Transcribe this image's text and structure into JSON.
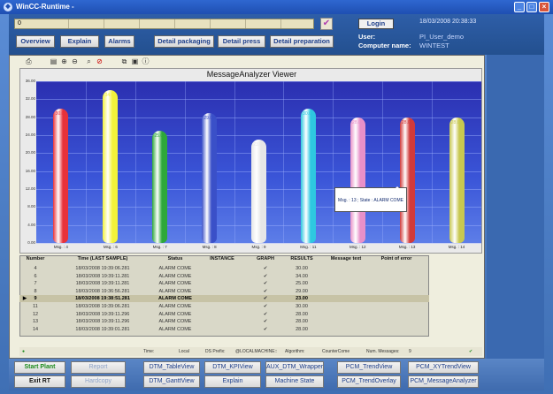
{
  "window": {
    "title": "WinCC-Runtime -"
  },
  "topbar": {
    "progress_label": "0",
    "login_label": "Login",
    "datetime": "18/03/2008 20:38:33",
    "user_label": "User:",
    "user_value": "PI_User_demo",
    "computer_label": "Computer name:",
    "computer_value": "WINTEST"
  },
  "nav": [
    "Overview",
    "Explain",
    "Alarms",
    "Detail packaging",
    "Detail press",
    "Detail preparation"
  ],
  "chart_data": {
    "type": "bar",
    "title": "MessageAnalyzer Viewer",
    "categories": [
      "Msg. : 4",
      "Msg. : 6",
      "Msg. : 7",
      "Msg. : 8",
      "Msg. : 9",
      "Msg. : 11",
      "Msg. : 12",
      "Msg. : 13",
      "Msg. : 14"
    ],
    "values": [
      30.0,
      34.0,
      25.0,
      29.0,
      23.0,
      30.0,
      28.0,
      28.0,
      28.0
    ],
    "value_labels": [
      "30.00",
      "34.00",
      "25.00",
      "29.00",
      "23.00",
      "30.00",
      "28.00",
      "28.00",
      "28.00"
    ],
    "ylim": [
      0,
      36
    ],
    "yticks": [
      "0.00",
      "4.00",
      "8.00",
      "12.00",
      "16.00",
      "20.00",
      "24.00",
      "28.00",
      "32.00",
      "36.00"
    ],
    "colors": [
      "#e8323a",
      "#f2f23a",
      "#2ea83a",
      "#3a50c8",
      "#e6e6e6",
      "#2ec8e0",
      "#e890c8",
      "#d03a3a",
      "#c8c850"
    ],
    "tooltip": "Msg. : 13 ; State : ALARM COME"
  },
  "table": {
    "headers": [
      "Number",
      "Time (LAST SAMPLE)",
      "Status",
      "INSTANCE",
      "GRAPH",
      "RESULTS",
      "Message text",
      "Point of error"
    ],
    "rows": [
      {
        "num": "4",
        "time": "18/03/2008 19:39:06.281",
        "status": "ALARM COME",
        "graph": "✔",
        "result": "30.00"
      },
      {
        "num": "6",
        "time": "18/03/2008 19:39:11.281",
        "status": "ALARM COME",
        "graph": "✔",
        "result": "34.00"
      },
      {
        "num": "7",
        "time": "18/03/2008 19:39:11.281",
        "status": "ALARM COME",
        "graph": "✔",
        "result": "25.00"
      },
      {
        "num": "8",
        "time": "18/03/2008 19:36:56.281",
        "status": "ALARM COME",
        "graph": "✔",
        "result": "29.00"
      },
      {
        "num": "9",
        "time": "18/03/2008 19:38:51.281",
        "status": "ALARM COME",
        "graph": "✔",
        "result": "23.00"
      },
      {
        "num": "11",
        "time": "18/03/2008 19:39:06.281",
        "status": "ALARM COME",
        "graph": "✔",
        "result": "30.00"
      },
      {
        "num": "12",
        "time": "18/03/2008 19:39:11.296",
        "status": "ALARM COME",
        "graph": "✔",
        "result": "28.00"
      },
      {
        "num": "13",
        "time": "18/03/2008 19:39:11.296",
        "status": "ALARM COME",
        "graph": "✔",
        "result": "28.00"
      },
      {
        "num": "14",
        "time": "18/03/2008 19:39:01.281",
        "status": "ALARM COME",
        "graph": "✔",
        "result": "28.00"
      }
    ],
    "selected_index": 4
  },
  "status": {
    "time_label": "Time:",
    "time_value": "Local",
    "ds_label": "DS Prefix:",
    "ds_value": "@LOCALMACHINE::",
    "algo_label": "Algorithm:",
    "algo_value": "CounterCome",
    "num_label": "Num. Messages:",
    "num_value": "9"
  },
  "bottom": {
    "start": "Start Plant",
    "exit": "Exit RT",
    "report": "Report",
    "hardcopy": "Hardcopy",
    "btns": [
      "DTM_TableView",
      "DTM_KPIView",
      "AUX_DTM_Wrapper",
      "PCM_TrendView",
      "PCM_XYTrendView",
      "DTM_GanttView",
      "Explain",
      "Machine State",
      "PCM_TrendOverlay",
      "PCM_MessageAnalyzer"
    ]
  }
}
